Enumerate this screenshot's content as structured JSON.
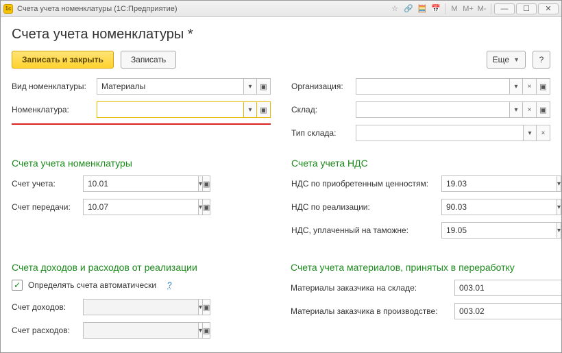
{
  "titlebar": {
    "title": "Счета учета номенклатуры  (1С:Предприятие)",
    "app_icon_label": "1С",
    "sys": {
      "m": "M",
      "mplus": "M+",
      "mminus": "M-",
      "min": "—",
      "max": "☐",
      "close": "✕"
    }
  },
  "page_title": "Счета учета номенклатуры *",
  "toolbar": {
    "save_close": "Записать и закрыть",
    "save": "Записать",
    "more": "Еще",
    "help": "?"
  },
  "top_left": {
    "nomenclature_type_label": "Вид номенклатуры:",
    "nomenclature_type_value": "Материалы",
    "nomenclature_label": "Номенклатура:",
    "nomenclature_value": ""
  },
  "top_right": {
    "org_label": "Организация:",
    "org_value": "",
    "warehouse_label": "Склад:",
    "warehouse_value": "",
    "warehouse_type_label": "Тип склада:",
    "warehouse_type_value": ""
  },
  "sec_nom": {
    "title": "Счета учета номенклатуры",
    "acc_label": "Счет учета:",
    "acc_value": "10.01",
    "transfer_label": "Счет передачи:",
    "transfer_value": "10.07"
  },
  "sec_nds": {
    "title": "Счета учета НДС",
    "purchased_label": "НДС по приобретенным ценностям:",
    "purchased_value": "19.03",
    "sales_label": "НДС по реализации:",
    "sales_value": "90.03",
    "customs_label": "НДС, уплаченный на таможне:",
    "customs_value": "19.05"
  },
  "sec_income": {
    "title": "Счета доходов и расходов от реализации",
    "auto_label": "Определять счета автоматически",
    "income_label": "Счет доходов:",
    "income_value": "",
    "expense_label": "Счет расходов:",
    "expense_value": ""
  },
  "sec_materials": {
    "title": "Счета учета материалов, принятых в переработку",
    "cust_stock_label": "Материалы заказчика на складе:",
    "cust_stock_value": "003.01",
    "cust_prod_label": "Материалы заказчика в производстве:",
    "cust_prod_value": "003.02"
  }
}
